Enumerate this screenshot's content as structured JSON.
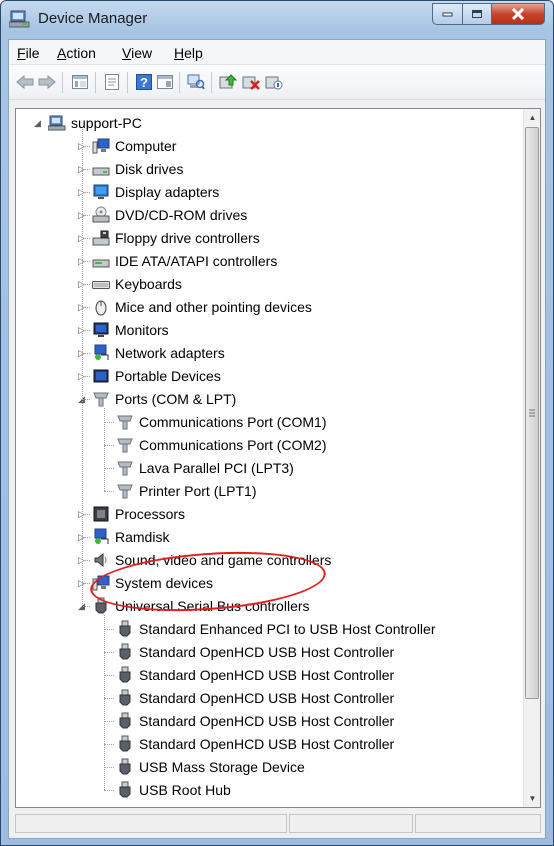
{
  "window": {
    "title": "Device Manager"
  },
  "menu": {
    "file": {
      "hot": "F",
      "rest": "ile"
    },
    "action": {
      "hot": "A",
      "rest": "ction"
    },
    "view": {
      "hot": "V",
      "rest": "iew"
    },
    "help": {
      "hot": "H",
      "rest": "elp"
    }
  },
  "toolbar": {
    "buttons": [
      "back-icon",
      "forward-icon",
      "show-hide-tree-icon",
      "properties-icon",
      "help-icon",
      "view-icon",
      "scan-hardware-icon",
      "update-driver-icon",
      "uninstall-icon",
      "disable-icon"
    ]
  },
  "tree": {
    "root": "support-PC",
    "categories": [
      {
        "label": "Computer",
        "icon": "computer-icon"
      },
      {
        "label": "Disk drives",
        "icon": "disk-drive-icon"
      },
      {
        "label": "Display adapters",
        "icon": "display-adapter-icon"
      },
      {
        "label": "DVD/CD-ROM drives",
        "icon": "dvd-drive-icon"
      },
      {
        "label": "Floppy drive controllers",
        "icon": "floppy-controller-icon"
      },
      {
        "label": "IDE ATA/ATAPI controllers",
        "icon": "ide-controller-icon"
      },
      {
        "label": "Keyboards",
        "icon": "keyboard-icon"
      },
      {
        "label": "Mice and other pointing devices",
        "icon": "mouse-icon"
      },
      {
        "label": "Monitors",
        "icon": "monitor-icon"
      },
      {
        "label": "Network adapters",
        "icon": "network-adapter-icon"
      },
      {
        "label": "Portable Devices",
        "icon": "portable-device-icon"
      },
      {
        "label": "Ports (COM & LPT)",
        "icon": "port-icon"
      },
      {
        "label": "Processors",
        "icon": "processor-icon"
      },
      {
        "label": "Ramdisk",
        "icon": "ramdisk-icon"
      },
      {
        "label": "Sound, video and game controllers",
        "icon": "sound-icon"
      },
      {
        "label": "System devices",
        "icon": "system-device-icon"
      },
      {
        "label": "Universal Serial Bus controllers",
        "icon": "usb-icon"
      }
    ],
    "ports_children": [
      "Communications Port (COM1)",
      "Communications Port (COM2)",
      "Lava Parallel PCI (LPT3)",
      "Printer Port (LPT1)"
    ],
    "usb_children": [
      "Standard Enhanced PCI to USB Host Controller",
      "Standard OpenHCD USB Host Controller",
      "Standard OpenHCD USB Host Controller",
      "Standard OpenHCD USB Host Controller",
      "Standard OpenHCD USB Host Controller",
      "Standard OpenHCD USB Host Controller",
      "USB Mass Storage Device",
      "USB Root Hub"
    ]
  },
  "annotation": {
    "highlight_color": "#e01e1e",
    "highlighted_item": "Lava Parallel PCI (LPT3)"
  }
}
